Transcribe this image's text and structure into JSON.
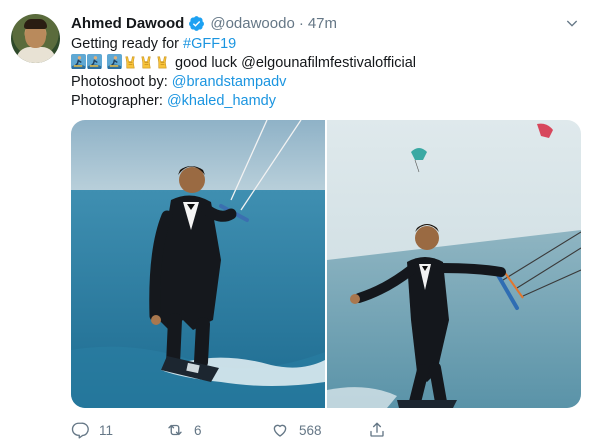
{
  "tweet": {
    "author_name": "Ahmed Dawood",
    "handle": "@odawoodo",
    "separator": "·",
    "time": "47m",
    "lines": {
      "l1_prefix": "Getting ready for ",
      "l1_hashtag": "#GFF19",
      "l2_text": "good luck @elgounafilmfestivalofficial",
      "l3_label": "Photoshoot by: ",
      "l3_link": "@brandstampadv",
      "l4_label": "Photographer: ",
      "l4_link": "@khaled_hamdy"
    },
    "emojis": [
      "surfer-emoji",
      "surfer-emoji",
      "surfer-emoji",
      "sign-of-horns-emoji",
      "sign-of-horns-emoji",
      "sign-of-horns-emoji"
    ],
    "media": [
      "kitesurf-photo-left",
      "kitesurf-photo-right"
    ]
  },
  "actions": {
    "replies": "11",
    "retweets": "6",
    "likes": "568"
  },
  "colors": {
    "link": "#1b95e0",
    "muted": "#657786",
    "text": "#14171a",
    "verified": "#1da1f2"
  }
}
